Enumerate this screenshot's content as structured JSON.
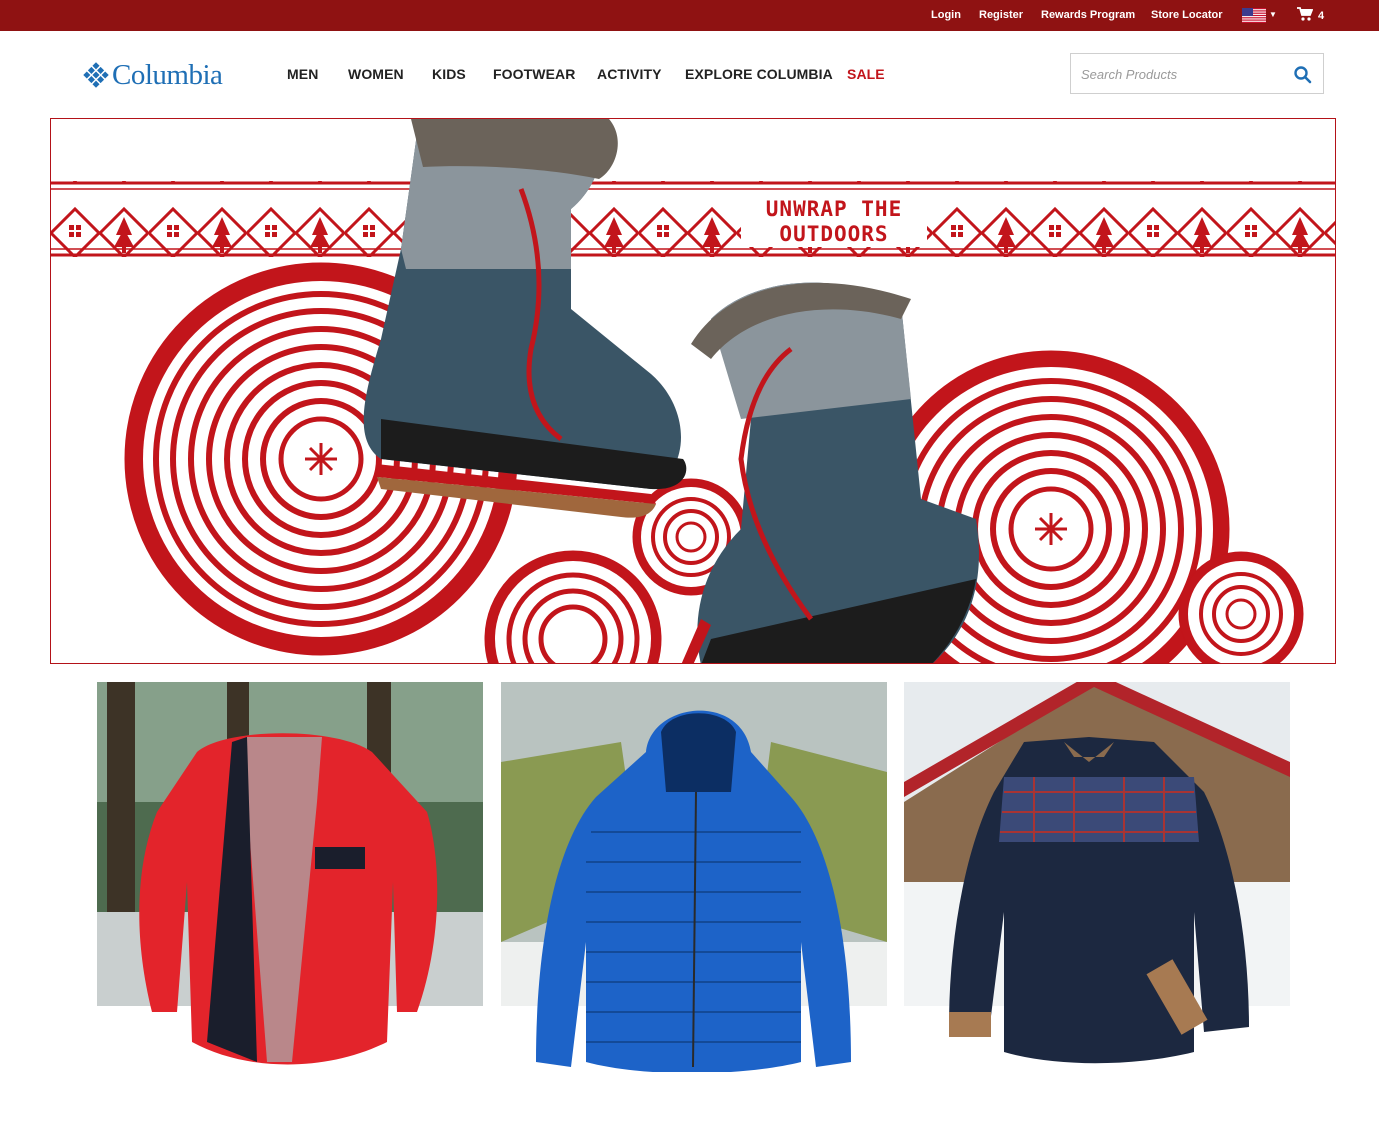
{
  "topbar": {
    "links": [
      "Login",
      "Register",
      "Rewards Program",
      "Store Locator"
    ],
    "cart_count": "4",
    "locale_icon": "us-flag-icon",
    "cart_icon": "shopping-cart-icon"
  },
  "brand": {
    "name": "Columbia",
    "logo_icon": "columbia-diamond-logo"
  },
  "nav": {
    "items": [
      "MEN",
      "WOMEN",
      "KIDS",
      "FOOTWEAR",
      "ACTIVITY",
      "EXPLORE COLUMBIA",
      "SALE"
    ]
  },
  "search": {
    "placeholder": "Search Products",
    "value": "",
    "icon": "search-icon"
  },
  "hero": {
    "headline_line1": "UNWRAP THE",
    "headline_line2": "OUTDOORS"
  },
  "products": [
    {
      "name": "red-fleece-jacket"
    },
    {
      "name": "blue-puffer-jacket"
    },
    {
      "name": "navy-quilted-shirt-jacket"
    }
  ],
  "colors": {
    "topbar": "#8f1212",
    "brand_blue": "#1f6fb5",
    "accent_red": "#c2151b",
    "sale_red": "#c2151b"
  }
}
